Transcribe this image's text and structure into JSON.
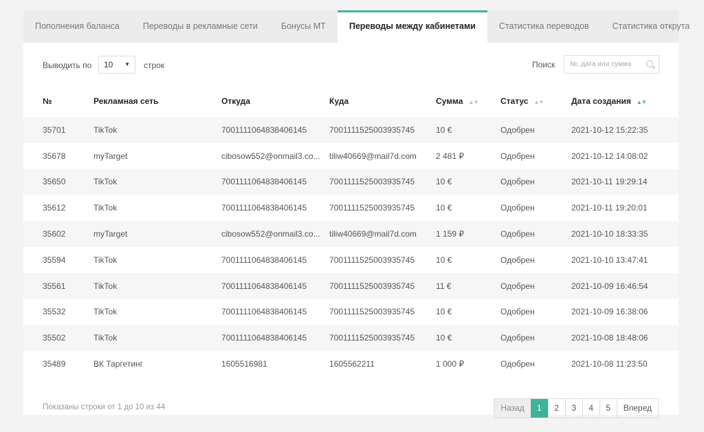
{
  "tabs": [
    {
      "label": "Пополнения баланса",
      "name": "tab-balance-topups"
    },
    {
      "label": "Переводы в рекламные сети",
      "name": "tab-transfers-to-networks"
    },
    {
      "label": "Бонусы МТ",
      "name": "tab-mt-bonuses"
    },
    {
      "label": "Переводы между кабинетами",
      "name": "tab-cabinet-transfers"
    },
    {
      "label": "Статистика переводов",
      "name": "tab-transfer-stats"
    },
    {
      "label": "Статистика открута",
      "name": "tab-spend-stats"
    }
  ],
  "active_tab": 3,
  "controls": {
    "show_label": "Выводить по",
    "page_size": "10",
    "rows_label": "строк",
    "search_label": "Поиск",
    "search_placeholder": "№, дата или сумма"
  },
  "table": {
    "headers": [
      "№",
      "Рекламная сеть",
      "Откуда",
      "Куда",
      "Сумма",
      "Статус",
      "Дата создания"
    ],
    "rows": [
      [
        "35701",
        "TikTok",
        "7001111064838406145",
        "7001111525003935745",
        "10 €",
        "Одобрен",
        "2021-10-12 15:22:35"
      ],
      [
        "35678",
        "myTarget",
        "cibosow552@onmail3.co...",
        "tiliw40669@mail7d.com",
        "2 481 ₽",
        "Одобрен",
        "2021-10-12 14:08:02"
      ],
      [
        "35650",
        "TikTok",
        "7001111064838406145",
        "7001111525003935745",
        "10 €",
        "Одобрен",
        "2021-10-11 19:29:14"
      ],
      [
        "35612",
        "TikTok",
        "7001111064838406145",
        "7001111525003935745",
        "10 €",
        "Одобрен",
        "2021-10-11 19:20:01"
      ],
      [
        "35602",
        "myTarget",
        "cibosow552@onmail3.co...",
        "tiliw40669@mail7d.com",
        "1 159 ₽",
        "Одобрен",
        "2021-10-10 18:33:35"
      ],
      [
        "35594",
        "TikTok",
        "7001111064838406145",
        "7001111525003935745",
        "10 €",
        "Одобрен",
        "2021-10-10 13:47:41"
      ],
      [
        "35561",
        "TikTok",
        "7001111064838406145",
        "7001111525003935745",
        "11 €",
        "Одобрен",
        "2021-10-09 16:46:54"
      ],
      [
        "35532",
        "TikTok",
        "7001111064838406145",
        "7001111525003935745",
        "10 €",
        "Одобрен",
        "2021-10-09 16:38:06"
      ],
      [
        "35502",
        "TikTok",
        "7001111064838406145",
        "7001111525003935745",
        "10 €",
        "Одобрен",
        "2021-10-08 18:48:06"
      ],
      [
        "35489",
        "ВК Таргетинг",
        "1605516981",
        "1605562211",
        "1 000 ₽",
        "Одобрен",
        "2021-10-08 11:23:50"
      ]
    ],
    "sort_icons": {
      "sum": "sort-icon",
      "status": "sort-icon",
      "date": "sort-desc-icon"
    }
  },
  "footer": {
    "info": "Показаны строки от 1 до 10 из 44",
    "prev": "Назад",
    "pages": [
      "1",
      "2",
      "3",
      "4",
      "5"
    ],
    "current_page": "1",
    "next": "Вперед"
  },
  "colors": {
    "accent": "#3fb39a",
    "tab_bar": "#ececec",
    "row_stripe": "#f6f6f6"
  }
}
